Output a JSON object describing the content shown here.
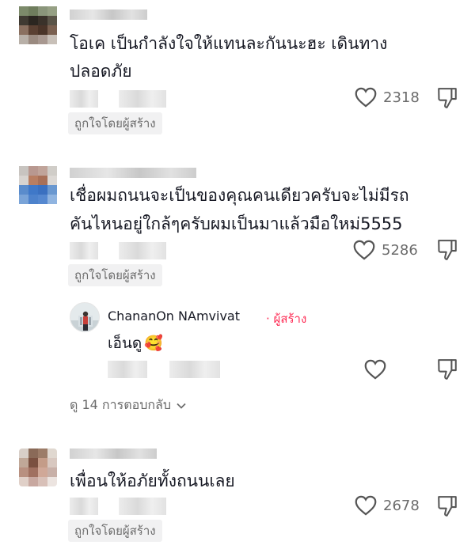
{
  "comments": [
    {
      "text_lines": [
        "โอเค เป็นกำลังใจให้แทนละกันนะฮะ เดินทาง",
        "ปลอดภัย"
      ],
      "like_count": "2318",
      "liked_by_creator": "ถูกใจโดยผู้สร้าง"
    },
    {
      "text_lines": [
        "เชื่อผมถนนจะเป็นของคุณคนเดียวครับจะไม่มีรถ",
        "คันไหนอยู่ใกล้ๆครับผมเป็นมาแล้วมือใหม่5555"
      ],
      "like_count": "5286",
      "liked_by_creator": "ถูกใจโดยผู้สร้าง"
    },
    {
      "text_lines": [
        "เพื่อนให้อภัยทั้งถนนเลย"
      ],
      "like_count": "2678",
      "liked_by_creator": "ถูกใจโดยผู้สร้าง"
    }
  ],
  "reply": {
    "author": "ChananOn NAmvivat",
    "creator_label": "· ผู้สร้าง",
    "text": "เอ็นดู",
    "emoji": "🥰"
  },
  "view_replies": {
    "label": "ดู 14 การตอบกลับ",
    "chevron": "⌵"
  },
  "icons": {
    "like": "heart-outline-icon",
    "dislike": "thumb-down-outline-icon"
  },
  "colors": {
    "text": "#161823",
    "secondary": "#6b6b6b",
    "creator": "#fe2c55",
    "chip_bg": "#f1f1f2"
  }
}
